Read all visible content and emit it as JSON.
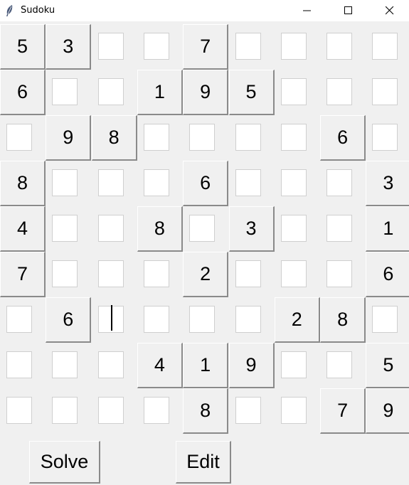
{
  "window": {
    "title": "Sudoku",
    "app_icon": "feather-icon"
  },
  "board": {
    "rows": [
      [
        5,
        3,
        null,
        null,
        7,
        null,
        null,
        null,
        null
      ],
      [
        6,
        null,
        null,
        1,
        9,
        5,
        null,
        null,
        null
      ],
      [
        null,
        9,
        8,
        null,
        null,
        null,
        null,
        6,
        null
      ],
      [
        8,
        null,
        null,
        null,
        6,
        null,
        null,
        null,
        3
      ],
      [
        4,
        null,
        null,
        8,
        null,
        3,
        null,
        null,
        1
      ],
      [
        7,
        null,
        null,
        null,
        2,
        null,
        null,
        null,
        6
      ],
      [
        null,
        6,
        null,
        null,
        null,
        null,
        2,
        8,
        null
      ],
      [
        null,
        null,
        null,
        4,
        1,
        9,
        null,
        null,
        5
      ],
      [
        null,
        null,
        null,
        null,
        8,
        null,
        null,
        7,
        9
      ]
    ],
    "focused_cell": {
      "row": 7,
      "col": 3
    }
  },
  "buttons": {
    "solve": "Solve",
    "edit": "Edit"
  }
}
